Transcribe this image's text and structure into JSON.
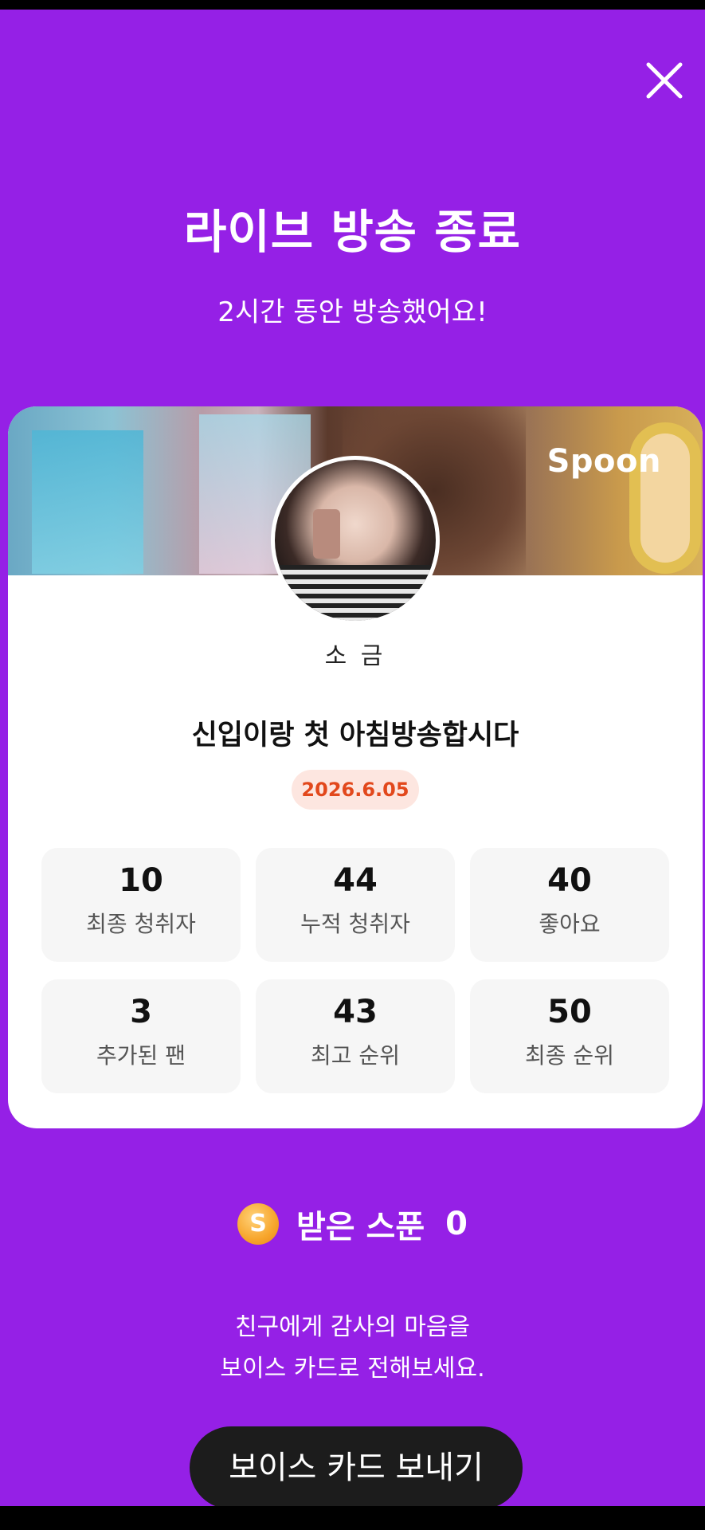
{
  "screen": {
    "title": "라이브 방송 종료",
    "subtitle": "2시간 동안 방송했어요!",
    "close_icon": "close-icon"
  },
  "card": {
    "brand": "Spoon",
    "username": "소 금",
    "broadcast_title": "신입이랑 첫 아침방송합시다",
    "date": "2026.6.05",
    "stats": [
      {
        "value": "10",
        "label": "최종 청취자"
      },
      {
        "value": "44",
        "label": "누적 청취자"
      },
      {
        "value": "40",
        "label": "좋아요"
      },
      {
        "value": "3",
        "label": "추가된 팬"
      },
      {
        "value": "43",
        "label": "최고 순위"
      },
      {
        "value": "50",
        "label": "최종 순위"
      }
    ]
  },
  "spoon": {
    "coin_letter": "S",
    "label": "받은 스푼",
    "count": "0"
  },
  "thanks": {
    "line1": "친구에게 감사의 마음을",
    "line2": "보이스 카드로 전해보세요."
  },
  "cta": {
    "label": "보이스 카드 보내기"
  },
  "colors": {
    "background": "#9520e6",
    "date_text": "#e2481c",
    "date_bg": "#fde6e0",
    "button_bg": "#1c1c1c"
  }
}
